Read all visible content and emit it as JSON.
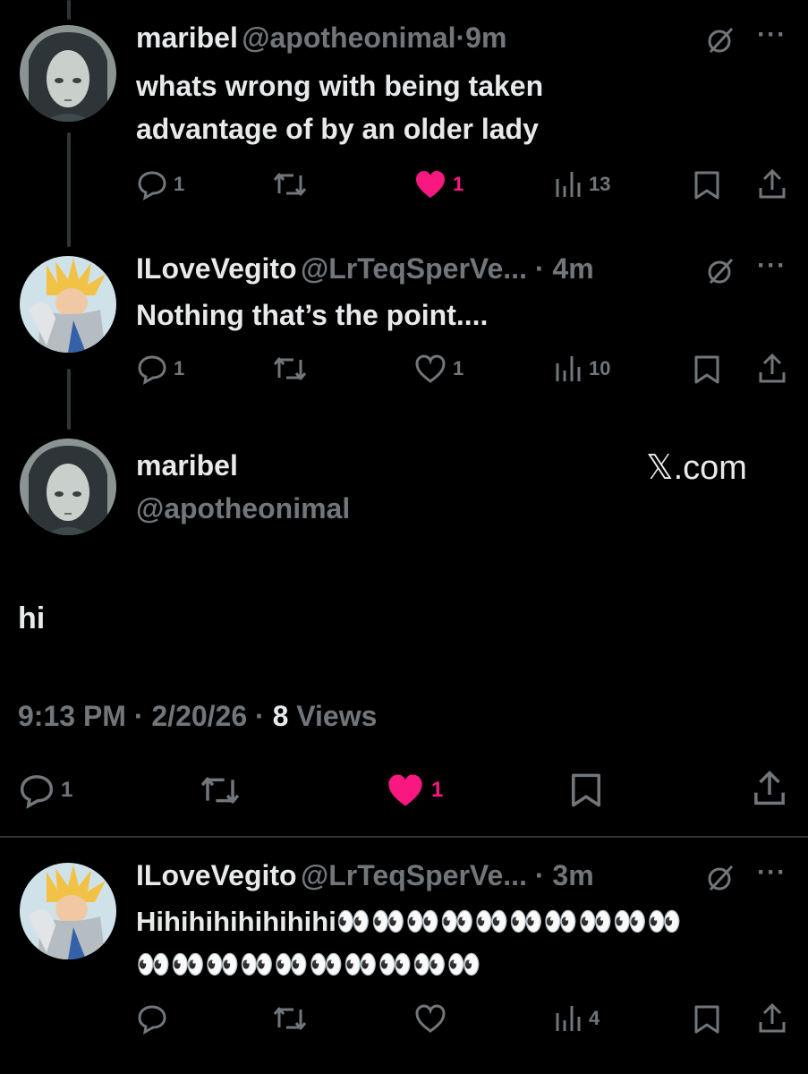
{
  "tweets": [
    {
      "name": "maribel",
      "handle": "@apotheonimal",
      "time": "9m",
      "lines": [
        "whats wrong with being taken",
        "advantage of by an older lady"
      ],
      "replies": "1",
      "likes": "1",
      "views": "13",
      "liked": true
    },
    {
      "name": "ILoveVegito",
      "handle": "@LrTeqSperVe...",
      "time": "4m",
      "lines": [
        "Nothing that’s the point...."
      ],
      "replies": "1",
      "likes": "1",
      "views": "10",
      "liked": false
    }
  ],
  "main": {
    "name": "maribel",
    "handle": "@apotheonimal",
    "watermark": "𝕏.com",
    "text": "hi",
    "time": "9:13 PM",
    "date": "2/20/26",
    "views_count": "8",
    "views_label": "Views",
    "replies": "1",
    "likes": "1"
  },
  "reply": {
    "name": "ILoveVegito",
    "handle": "@LrTeqSperVe...",
    "time": "3m",
    "line1": "Hihihihihihihihi👀👀👀👀👀👀👀👀👀👀",
    "line2": "👀👀👀👀👀👀👀👀👀👀",
    "views": "4"
  },
  "colors": {
    "background": "#000000",
    "text": "#e7e9ea",
    "muted": "#71767b",
    "like": "#f91880"
  }
}
